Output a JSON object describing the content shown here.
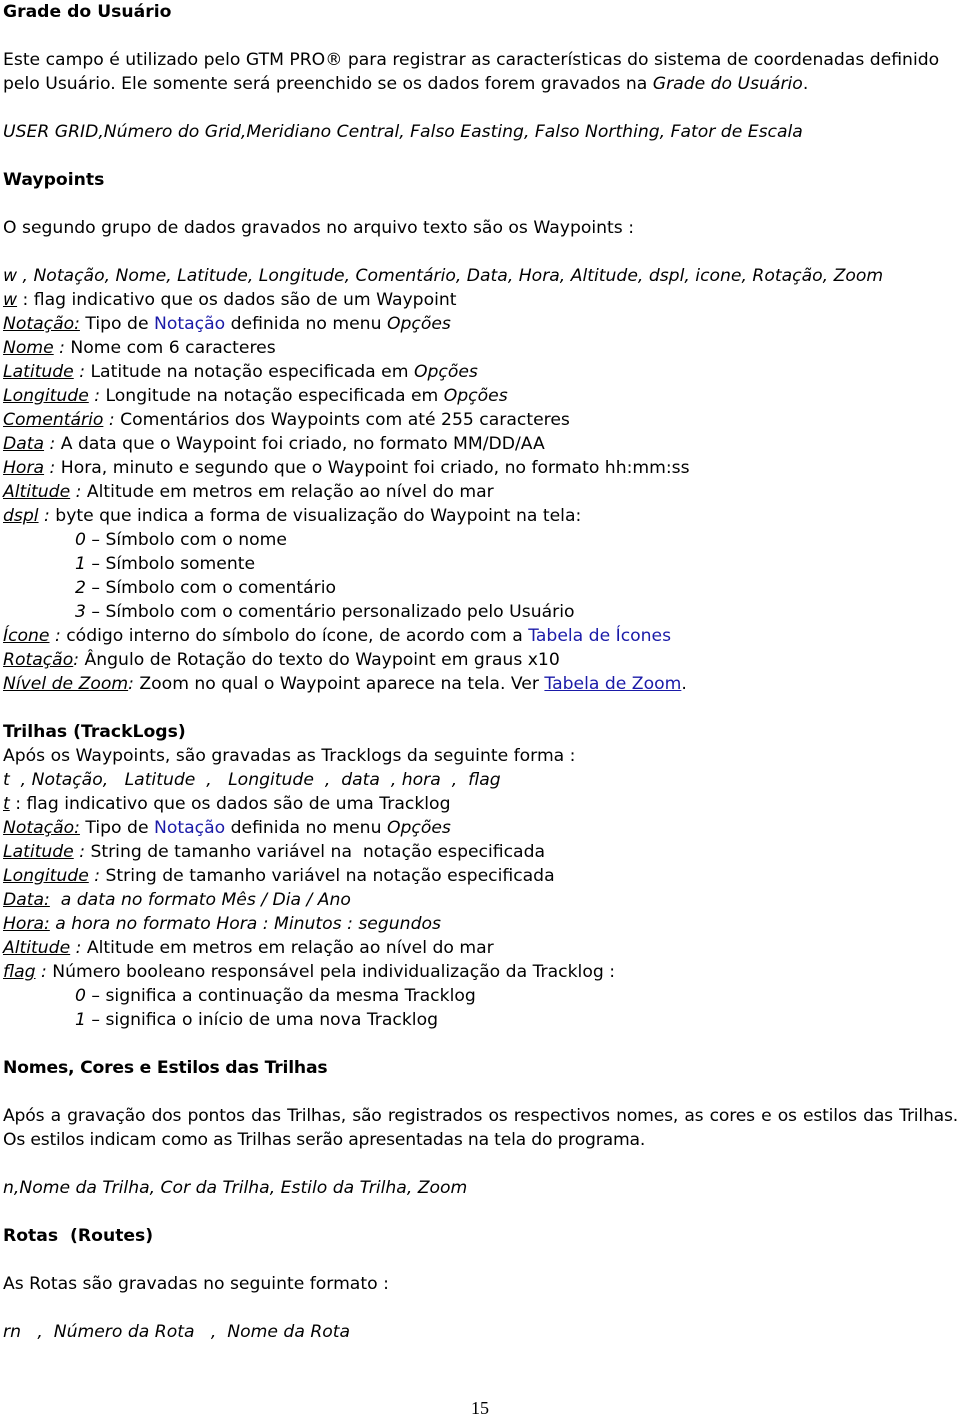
{
  "grade": {
    "heading": "Grade do Usuário",
    "para_line1": "Este campo é utilizado pelo GTM PRO® para registrar as características do sistema de coordenadas definido",
    "para_line2_a": "pelo Usuário. Ele somente será preenchido se os dados forem gravados na ",
    "para_line2_b": "Grade do Usuário",
    "para_line2_c": ".",
    "format": "USER GRID,Número do Grid,Meridiano Central, Falso Easting, Falso Northing, Fator de Escala"
  },
  "waypoints": {
    "heading": "Waypoints",
    "intro": "O segundo grupo de dados gravados no arquivo texto são os Waypoints :",
    "format": "w , Notação, Nome, Latitude, Longitude, Comentário, Data, Hora, Altitude, dspl, icone, Rotação, Zoom",
    "fields": {
      "w": {
        "term": "w",
        "sep": " : ",
        "desc": "flag indicativo que os dados são de um Waypoint"
      },
      "notacao": {
        "term": "Notação:",
        "desc_a": " Tipo de ",
        "link": "Notação",
        "desc_b": " definida no menu ",
        "menu": "Opções"
      },
      "nome": {
        "term": "Nome",
        "sep": " : ",
        "desc": "Nome com  6 caracteres"
      },
      "latitude": {
        "term": "Latitude",
        "sep": " : ",
        "desc": "Latitude na notação especificada em ",
        "menu": "Opções"
      },
      "longitude": {
        "term": "Longitude",
        "sep": " : ",
        "desc": "Longitude na notação especificada em ",
        "menu": "Opções"
      },
      "comentario": {
        "term": "Comentário",
        "sep": " : ",
        "desc": "Comentários dos Waypoints com até 255 caracteres"
      },
      "data": {
        "term": "Data",
        "sep": " : ",
        "desc": "A data que o Waypoint foi criado, no formato MM/DD/AA"
      },
      "hora": {
        "term": "Hora",
        "sep": " : ",
        "desc": "Hora, minuto e segundo que o Waypoint foi criado, no formato hh:mm:ss"
      },
      "altitude": {
        "term": "Altitude",
        "sep": " : ",
        "desc": "Altitude em metros em relação ao nível do mar"
      },
      "dspl": {
        "term": "dspl",
        "sep": " : ",
        "desc": "byte que indica a forma de visualização do Waypoint na tela:"
      },
      "icone": {
        "term": "Ícone",
        "sep": " : ",
        "desc": "código interno do símbolo do ícone, de acordo com a ",
        "link": "Tabela de Ícones"
      },
      "rotacao": {
        "term": "Rotação",
        "sep": ": ",
        "desc": "Ângulo de Rotação do texto do Waypoint em graus x10"
      },
      "zoom": {
        "term": "Nível de Zoom",
        "sep": ": ",
        "desc": "Zoom no qual o Waypoint aparece na tela. Ver ",
        "link": "Tabela de Zoom",
        "end": "."
      }
    },
    "dspl_options": [
      {
        "code": "0",
        "desc": " – Símbolo com o nome"
      },
      {
        "code": "1",
        "desc": " – Símbolo somente"
      },
      {
        "code": "2",
        "desc": " – Símbolo com o comentário"
      },
      {
        "code": "3",
        "desc": " – Símbolo com o comentário personalizado pelo Usuário"
      }
    ]
  },
  "trilhas": {
    "heading": "Trilhas (TrackLogs)",
    "intro": "Após os Waypoints, são gravadas as Tracklogs da seguinte forma :",
    "format": "t  , Notação,   Latitude  ,   Longitude  ,  data  , hora  ,  flag",
    "fields": {
      "t": {
        "term": "t",
        "sep": " : ",
        "desc": "flag indicativo que os dados são de uma Tracklog"
      },
      "notacao": {
        "term": "Notação:",
        "desc_a": " Tipo de ",
        "link": "Notação",
        "desc_b": " definida no menu ",
        "menu": "Opções"
      },
      "latitude": {
        "term": "Latitude",
        "sep": " : ",
        "desc": "String de tamanho variável na  notação especificada"
      },
      "longitude": {
        "term": "Longitude",
        "sep": " : ",
        "desc": "String de tamanho variável na notação especificada"
      },
      "data": {
        "term": "Data:",
        "desc": "  a data no formato Mês / Dia / Ano"
      },
      "hora": {
        "term": "Hora:",
        "desc": " a hora no formato Hora : Minutos : segundos"
      },
      "altitude": {
        "term": "Altitude",
        "sep": " : ",
        "desc": "Altitude em metros em relação ao nível do mar"
      },
      "flag": {
        "term": "flag",
        "sep": " : ",
        "desc": "Número booleano responsável pela individualização da Tracklog :"
      }
    },
    "flag_options": [
      {
        "code": "0",
        "desc": " – significa a continuação da mesma Tracklog"
      },
      {
        "code": "1",
        "desc": " – significa o início de uma nova Tracklog"
      }
    ]
  },
  "nomes": {
    "heading": "Nomes, Cores e Estilos das Trilhas",
    "para": "Após a gravação dos pontos das Trilhas, são registrados os respectivos nomes, as cores e os estilos das Trilhas. Os estilos indicam como as Trilhas serão apresentadas na tela do programa.",
    "format": "n,Nome da Trilha, Cor da Trilha, Estilo da Trilha, Zoom"
  },
  "rotas": {
    "heading": "Rotas  (Routes)",
    "intro": "As Rotas são gravadas no seguinte formato :",
    "format": "rn   ,  Número da Rota   ,  Nome da Rota"
  },
  "page_number": "15"
}
